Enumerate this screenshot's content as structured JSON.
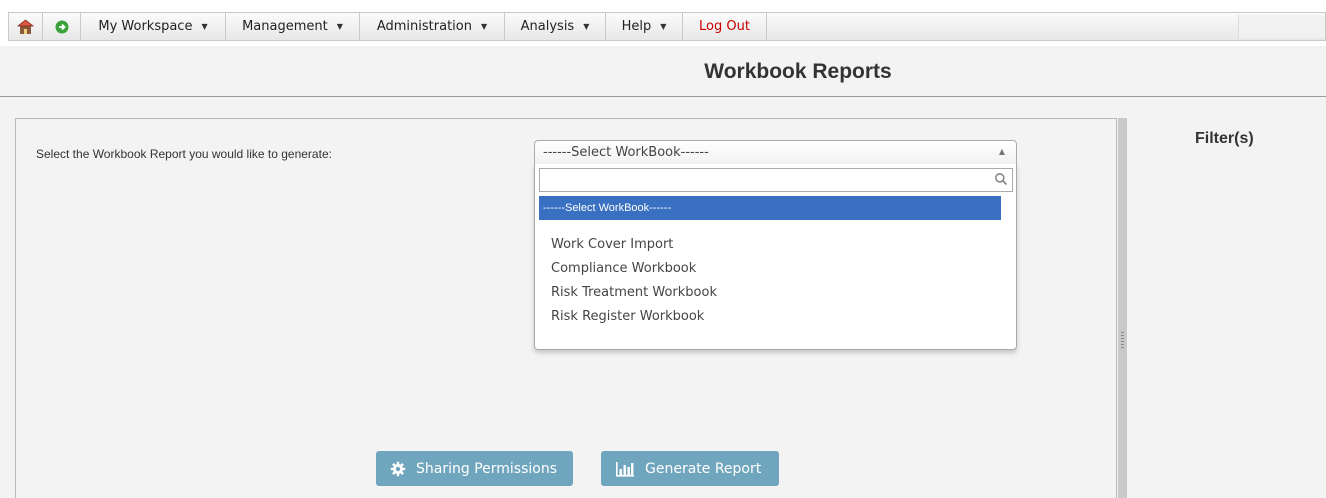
{
  "menu": {
    "home_icon": "home-icon",
    "refresh_icon": "refresh-icon",
    "items": [
      {
        "label": "My Workspace",
        "dropdown": true
      },
      {
        "label": "Management",
        "dropdown": true
      },
      {
        "label": "Administration",
        "dropdown": true
      },
      {
        "label": "Analysis",
        "dropdown": true
      },
      {
        "label": "Help",
        "dropdown": true
      }
    ],
    "logout_label": "Log Out",
    "logout_color": "#cc0000"
  },
  "page": {
    "title": "Workbook Reports"
  },
  "form": {
    "prompt": "Select the Workbook Report you would like to generate:",
    "select_value": "------Select WorkBook------",
    "search_value": "",
    "options": [
      "------Select WorkBook------",
      "Work Cover Import",
      "Compliance Workbook",
      "Risk Treatment Workbook",
      "Risk Register Workbook"
    ],
    "selected_color": "#3a70c2"
  },
  "filters": {
    "title": "Filter(s)"
  },
  "buttons": {
    "sharing": "Sharing Permissions",
    "generate": "Generate Report",
    "color": "#6fa5bd"
  }
}
